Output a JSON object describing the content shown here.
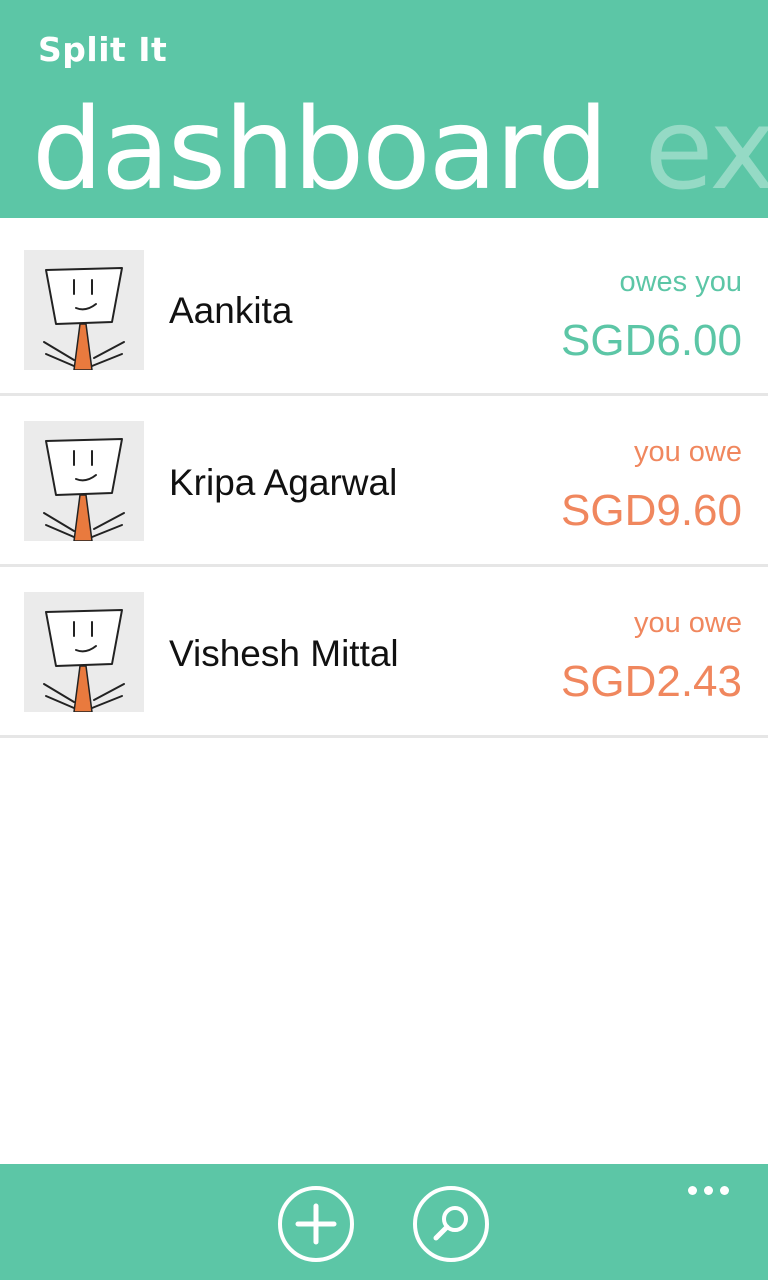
{
  "app": {
    "title": "Split It"
  },
  "pivot": {
    "active": "dashboard",
    "next": "exp"
  },
  "friends": [
    {
      "name": "Aankita",
      "status": "owes you",
      "amount": "SGD6.00",
      "direction": "positive"
    },
    {
      "name": "Kripa Agarwal",
      "status": "you owe",
      "amount": "SGD9.60",
      "direction": "negative"
    },
    {
      "name": "Vishesh Mittal",
      "status": "you owe",
      "amount": "SGD2.43",
      "direction": "negative"
    }
  ],
  "appbar": {
    "buttons": [
      {
        "icon": "add-icon"
      },
      {
        "icon": "search-icon"
      },
      {
        "icon": "more-icon"
      }
    ]
  },
  "colors": {
    "accent": "#5cc6a6",
    "negative": "#f0875e",
    "positive": "#5cc6a6"
  }
}
